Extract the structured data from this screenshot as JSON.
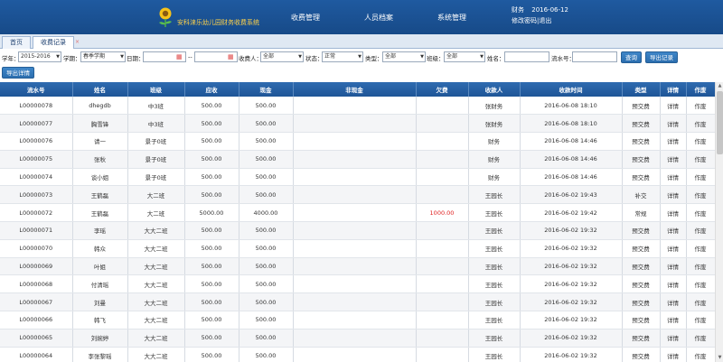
{
  "header": {
    "app_title": "安科涞乐幼儿园财务收费系统",
    "nav": [
      "收费管理",
      "人员档案",
      "系统管理"
    ],
    "user_role": "财务",
    "date": "2016-06-12",
    "change_password": "修改密码",
    "separator": "|",
    "logout": "退出"
  },
  "tabs": {
    "home": "首页",
    "records": "收费记录",
    "close": "×"
  },
  "filters": {
    "school_year_label": "学年：",
    "school_year": "2015-2016",
    "term_label": "学期：",
    "term": "春季学期",
    "date_label": "日期：",
    "date_sep": "--",
    "payee_label": "收费人：",
    "payee": "全部",
    "status_label": "状态：",
    "status": "正常",
    "type_label": "类型：",
    "type": "全部",
    "class_label": "班级：",
    "class": "全部",
    "name_label": "姓名：",
    "serial_label": "流水号：",
    "query_button": "查询",
    "export_records_button": "导出记录",
    "export_details_button": "导出详情"
  },
  "table": {
    "headers": [
      "流水号",
      "姓名",
      "班级",
      "应收",
      "现金",
      "非现金",
      "欠费",
      "收款人",
      "收款时间",
      "类型",
      "详情",
      "作废"
    ],
    "rows": [
      [
        "L00000078",
        "dhegdb",
        "中3班",
        "500.00",
        "500.00",
        "",
        "",
        "张财务",
        "2016-06-08 18:10",
        "预交费",
        "详情",
        "作废"
      ],
      [
        "L00000077",
        "胸雪锋",
        "中3班",
        "500.00",
        "500.00",
        "",
        "",
        "张财务",
        "2016-06-08 18:10",
        "预交费",
        "详情",
        "作废"
      ],
      [
        "L00000076",
        "请一",
        "景子0班",
        "500.00",
        "500.00",
        "",
        "",
        "财务",
        "2016-06-08 14:46",
        "预交费",
        "详情",
        "作废"
      ],
      [
        "L00000075",
        "张秋",
        "景子0班",
        "500.00",
        "500.00",
        "",
        "",
        "财务",
        "2016-06-08 14:46",
        "预交费",
        "详情",
        "作废"
      ],
      [
        "L00000074",
        "谈小姐",
        "景子0班",
        "500.00",
        "500.00",
        "",
        "",
        "财务",
        "2016-06-08 14:46",
        "预交费",
        "详情",
        "作废"
      ],
      [
        "L00000073",
        "王鹤磊",
        "大二班",
        "500.00",
        "500.00",
        "",
        "",
        "王园长",
        "2016-06-02 19:43",
        "补交",
        "详情",
        "作废"
      ],
      [
        "L00000072",
        "王鹤磊",
        "大二班",
        "5000.00",
        "4000.00",
        "",
        "1000.00",
        "王园长",
        "2016-06-02 19:42",
        "常规",
        "详情",
        "作废"
      ],
      [
        "L00000071",
        "李瑶",
        "大大二班",
        "500.00",
        "500.00",
        "",
        "",
        "王园长",
        "2016-06-02 19:32",
        "预交费",
        "详情",
        "作废"
      ],
      [
        "L00000070",
        "韩众",
        "大大二班",
        "500.00",
        "500.00",
        "",
        "",
        "王园长",
        "2016-06-02 19:32",
        "预交费",
        "详情",
        "作废"
      ],
      [
        "L00000069",
        "叶姐",
        "大大二班",
        "500.00",
        "500.00",
        "",
        "",
        "王园长",
        "2016-06-02 19:32",
        "预交费",
        "详情",
        "作废"
      ],
      [
        "L00000068",
        "付清瑶",
        "大大二班",
        "500.00",
        "500.00",
        "",
        "",
        "王园长",
        "2016-06-02 19:32",
        "预交费",
        "详情",
        "作废"
      ],
      [
        "L00000067",
        "刘曼",
        "大大二班",
        "500.00",
        "500.00",
        "",
        "",
        "王园长",
        "2016-06-02 19:32",
        "预交费",
        "详情",
        "作废"
      ],
      [
        "L00000066",
        "韩飞",
        "大大二班",
        "500.00",
        "500.00",
        "",
        "",
        "王园长",
        "2016-06-02 19:32",
        "预交费",
        "详情",
        "作废"
      ],
      [
        "L00000065",
        "刘婉婷",
        "大大二班",
        "500.00",
        "500.00",
        "",
        "",
        "王园长",
        "2016-06-02 19:32",
        "预交费",
        "详情",
        "作废"
      ],
      [
        "L00000064",
        "李张黎瑶",
        "大大二班",
        "500.00",
        "500.00",
        "",
        "",
        "王园长",
        "2016-06-02 19:32",
        "预交费",
        "详情",
        "作废"
      ]
    ]
  },
  "colors": {
    "header_bg": "#1f5aa0",
    "arrears_text": "#e02020",
    "logo_text": "#ffd24a"
  }
}
